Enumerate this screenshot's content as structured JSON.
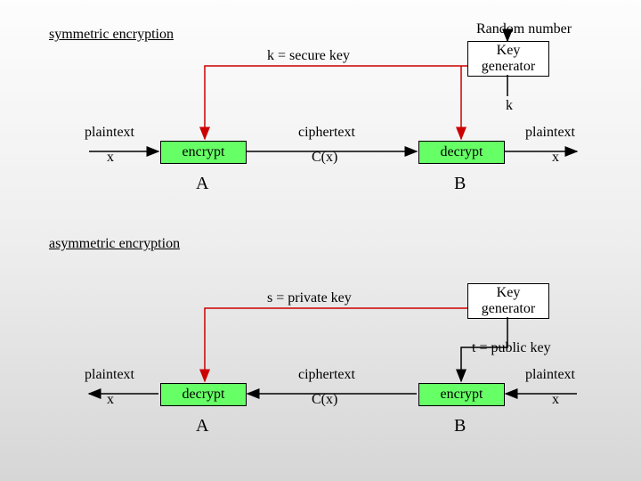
{
  "symmetric": {
    "title": "symmetric encryption",
    "random_number": "Random number",
    "key_label": "k = secure key",
    "key_gen": "Key\ngenerator",
    "k_out": "k",
    "plaintext_left": "plaintext",
    "ciphertext": "ciphertext",
    "plaintext_right": "plaintext",
    "encrypt": "encrypt",
    "decrypt": "decrypt",
    "x_left": "x",
    "cx": "C(x)",
    "x_right": "x",
    "A": "A",
    "B": "B"
  },
  "asymmetric": {
    "title": "asymmetric encryption",
    "private_key": "s = private key",
    "key_gen": "Key\ngenerator",
    "public_key": "t =  public key",
    "plaintext_left": "plaintext",
    "ciphertext": "ciphertext",
    "plaintext_right": "plaintext",
    "decrypt": "decrypt",
    "encrypt": "encrypt",
    "x_left": "x",
    "cx": "C(x)",
    "x_right": "x",
    "A": "A",
    "B": "B"
  }
}
